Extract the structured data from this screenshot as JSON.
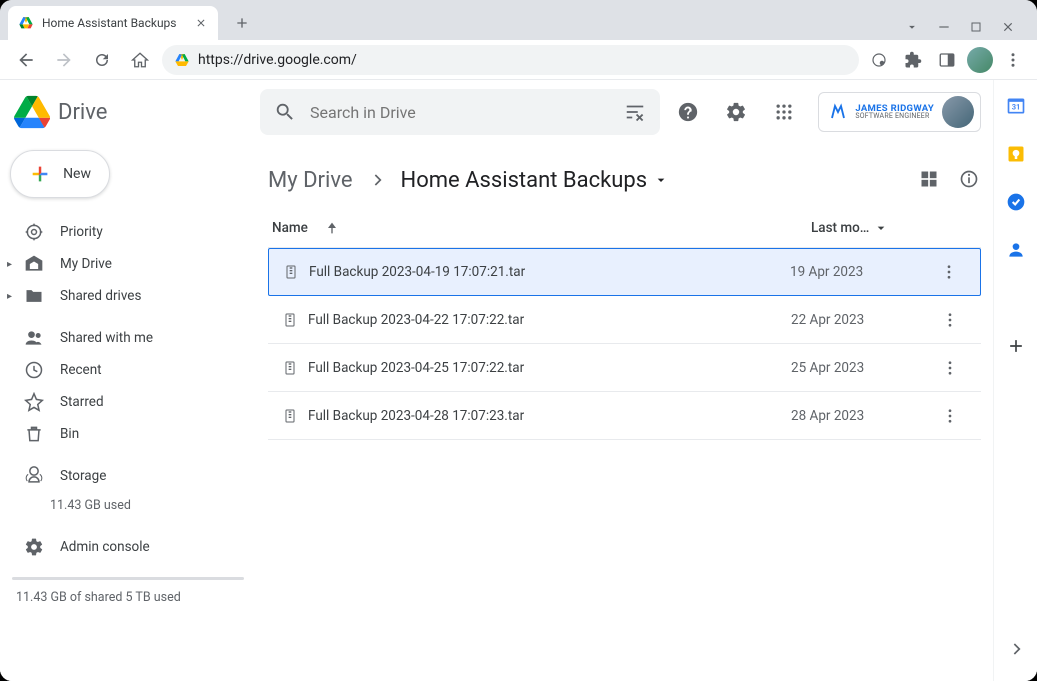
{
  "browser": {
    "tab_title": "Home Assistant Backups",
    "url": "https://drive.google.com/"
  },
  "app": {
    "product_name": "Drive",
    "new_button_label": "New",
    "search_placeholder": "Search in Drive"
  },
  "sidebar": {
    "items": [
      {
        "label": "Priority"
      },
      {
        "label": "My Drive"
      },
      {
        "label": "Shared drives"
      },
      {
        "label": "Shared with me"
      },
      {
        "label": "Recent"
      },
      {
        "label": "Starred"
      },
      {
        "label": "Bin"
      },
      {
        "label": "Storage"
      }
    ],
    "storage_used": "11.43 GB used",
    "admin_console": "Admin console",
    "storage_footer": "11.43 GB of shared 5 TB used"
  },
  "brand": {
    "line1": "JAMES RIDGWAY",
    "line2": "SOFTWARE ENGINEER"
  },
  "breadcrumb": {
    "root": "My Drive",
    "current": "Home Assistant Backups"
  },
  "list": {
    "col_name": "Name",
    "col_date": "Last mo…"
  },
  "files": [
    {
      "name": "Full Backup 2023-04-19 17:07:21.tar",
      "date": "19 Apr 2023",
      "selected": true
    },
    {
      "name": "Full Backup 2023-04-22 17:07:22.tar",
      "date": "22 Apr 2023",
      "selected": false
    },
    {
      "name": "Full Backup 2023-04-25 17:07:22.tar",
      "date": "25 Apr 2023",
      "selected": false
    },
    {
      "name": "Full Backup 2023-04-28 17:07:23.tar",
      "date": "28 Apr 2023",
      "selected": false
    }
  ]
}
